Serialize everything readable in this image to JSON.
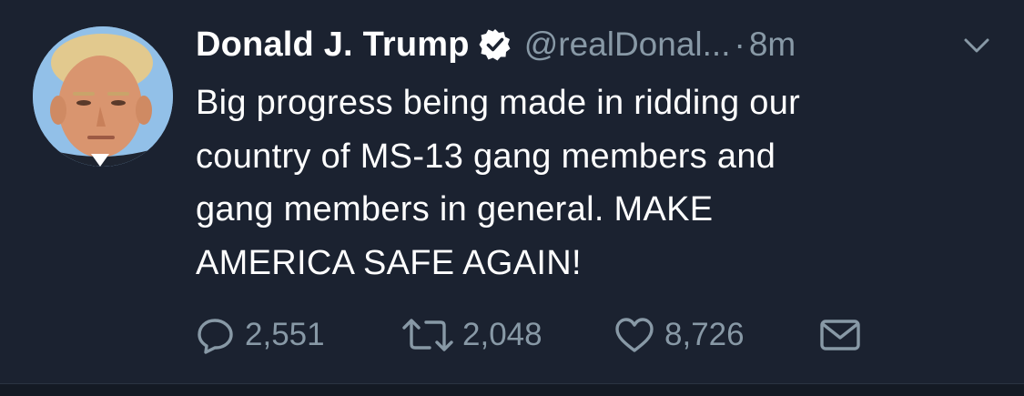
{
  "tweet": {
    "author_name": "Donald J. Trump",
    "handle": "@realDonal...",
    "separator": "·",
    "time": "8m",
    "lines": [
      "Big progress being made in ridding our",
      "country of MS-13 gang members and",
      "gang members in general. MAKE",
      "AMERICA SAFE AGAIN!"
    ]
  },
  "actions": {
    "reply_count": "2,551",
    "retweet_count": "2,048",
    "like_count": "8,726"
  },
  "icons": {
    "verified": "verified-badge-icon",
    "menu": "chevron-down-icon",
    "reply": "reply-icon",
    "retweet": "retweet-icon",
    "like": "heart-icon",
    "dm": "envelope-icon"
  },
  "colors": {
    "background": "#1b2230",
    "text": "#ffffff",
    "muted": "#8899a6"
  }
}
